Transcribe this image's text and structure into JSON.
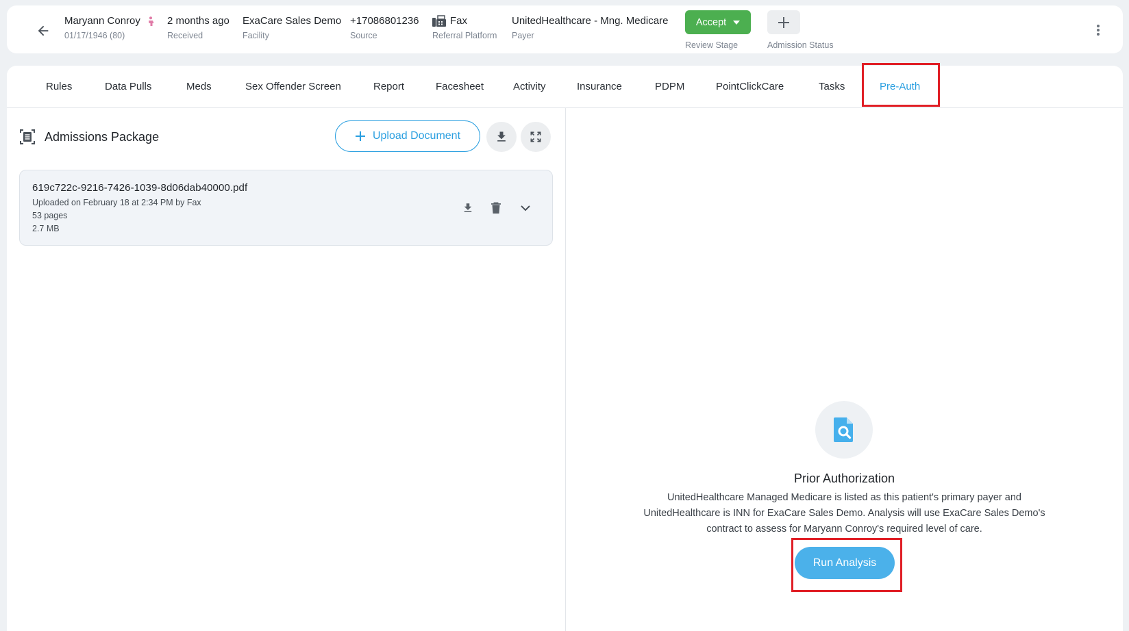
{
  "header": {
    "patient_name": "Maryann Conroy",
    "patient_dob": "01/17/1946 (80)",
    "received_value": "2 months ago",
    "received_label": "Received",
    "facility_value": "ExaCare Sales Demo",
    "facility_label": "Facility",
    "source_value": "+17086801236",
    "source_label": "Source",
    "platform_value": "Fax",
    "platform_label": "Referral Platform",
    "payer_value": "UnitedHealthcare - Mng. Medicare",
    "payer_label": "Payer",
    "accept_label": "Accept",
    "review_stage_label": "Review Stage",
    "admission_status_label": "Admission Status"
  },
  "tabs": [
    {
      "label": "Rules"
    },
    {
      "label": "Data Pulls"
    },
    {
      "label": "Meds"
    },
    {
      "label": "Sex Offender Screen"
    },
    {
      "label": "Report"
    },
    {
      "label": "Facesheet"
    },
    {
      "label": "Activity"
    },
    {
      "label": "Insurance"
    },
    {
      "label": "PDPM"
    },
    {
      "label": "PointClickCare"
    },
    {
      "label": "Tasks"
    },
    {
      "label": "Pre-Auth",
      "active": true
    }
  ],
  "package": {
    "title": "Admissions Package",
    "upload_label": "Upload Document",
    "document": {
      "filename": "619c722c-9216-7426-1039-8d06dab40000.pdf",
      "uploaded": "Uploaded on February 18 at 2:34 PM by Fax",
      "pages": "53 pages",
      "size": "2.7 MB"
    }
  },
  "prior_auth": {
    "title": "Prior Authorization",
    "line1": "UnitedHealthcare Managed Medicare is listed as this patient's primary payer and",
    "line2": "UnitedHealthcare is INN for ExaCare Sales Demo. Analysis will use ExaCare Sales Demo's",
    "line3": "contract to assess for Maryann Conroy's required level of care.",
    "run_label": "Run Analysis"
  },
  "colors": {
    "accent": "#2a9fe0",
    "accept_green": "#4caf50",
    "highlight_red": "#e01f26",
    "run_button": "#4bb1ea"
  }
}
